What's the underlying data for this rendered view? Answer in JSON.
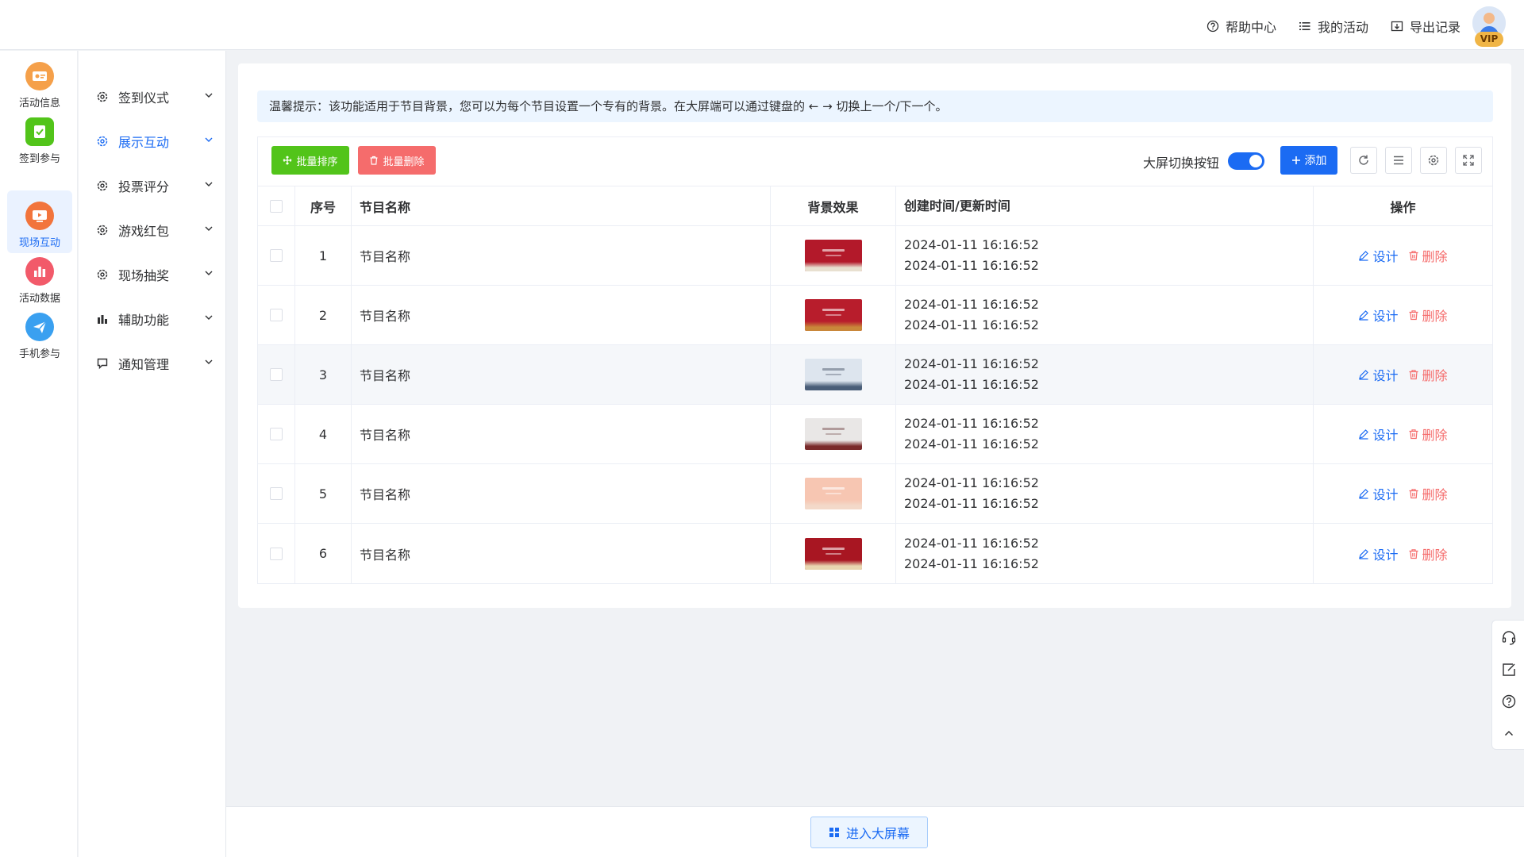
{
  "header": {
    "links": [
      {
        "label": "帮助中心",
        "icon": "help-circle-icon"
      },
      {
        "label": "我的活动",
        "icon": "list-icon"
      },
      {
        "label": "导出记录",
        "icon": "export-icon"
      }
    ],
    "badge": "VIP"
  },
  "rail": {
    "items": [
      {
        "label": "活动信息",
        "color": "#f08a3a"
      },
      {
        "label": "签到参与",
        "color": "#4caf50"
      },
      {
        "label": "现场互动",
        "color": "#f06a3a",
        "active": true
      },
      {
        "label": "活动数据",
        "color": "#f05a6a"
      },
      {
        "label": "手机参与",
        "color": "#3aa0f0"
      }
    ]
  },
  "submenu": {
    "items": [
      {
        "label": "签到仪式",
        "icon": "gear-icon"
      },
      {
        "label": "展示互动",
        "icon": "gear-icon",
        "active": true
      },
      {
        "label": "投票评分",
        "icon": "gear-icon"
      },
      {
        "label": "游戏红包",
        "icon": "gear-icon"
      },
      {
        "label": "现场抽奖",
        "icon": "gear-icon"
      },
      {
        "label": "辅助功能",
        "icon": "bar-chart-icon"
      },
      {
        "label": "通知管理",
        "icon": "chat-bubble-icon"
      }
    ]
  },
  "tip": "温馨提示：该功能适用于节目背景，您可以为每个节目设置一个专有的背景。在大屏端可以通过键盘的 ← → 切换上一个/下一个。",
  "toolbar": {
    "batch_sort": "批量排序",
    "batch_delete": "批量删除",
    "switch_label": "大屏切换按钮",
    "switch_on": true,
    "add": "添加"
  },
  "table": {
    "headers": {
      "no": "序号",
      "name": "节目名称",
      "bg": "背景效果",
      "time": "创建时间/更新时间",
      "op": "操作"
    },
    "rows": [
      {
        "no": "1",
        "name": "节目名称",
        "created": "2024-01-11 16:16:52",
        "updated": "2024-01-11 16:16:52",
        "thumb_color": "#b3192a",
        "hill_color": "#e8e0d0"
      },
      {
        "no": "2",
        "name": "节目名称",
        "created": "2024-01-11 16:16:52",
        "updated": "2024-01-11 16:16:52",
        "thumb_color": "#b81d2c",
        "hill_color": "#c9873a"
      },
      {
        "no": "3",
        "name": "节目名称",
        "created": "2024-01-11 16:16:52",
        "updated": "2024-01-11 16:16:52",
        "thumb_color": "#dde5ee",
        "hill_color": "#4a5e78"
      },
      {
        "no": "4",
        "name": "节目名称",
        "created": "2024-01-11 16:16:52",
        "updated": "2024-01-11 16:16:52",
        "thumb_color": "#e9e7e6",
        "hill_color": "#7a2a2a"
      },
      {
        "no": "5",
        "name": "节目名称",
        "created": "2024-01-11 16:16:52",
        "updated": "2024-01-11 16:16:52",
        "thumb_color": "#f7c6b2",
        "hill_color": "#f3d9c9"
      },
      {
        "no": "6",
        "name": "节目名称",
        "created": "2024-01-11 16:16:52",
        "updated": "2024-01-11 16:16:52",
        "thumb_color": "#a81622",
        "hill_color": "#e8d6b0"
      }
    ],
    "design": "设计",
    "delete": "删除"
  },
  "bottom": {
    "enter_screen": "进入大屏幕"
  },
  "colors": {
    "primary": "#1b6bf3",
    "success": "#52c41a",
    "danger": "#f56c6c"
  }
}
